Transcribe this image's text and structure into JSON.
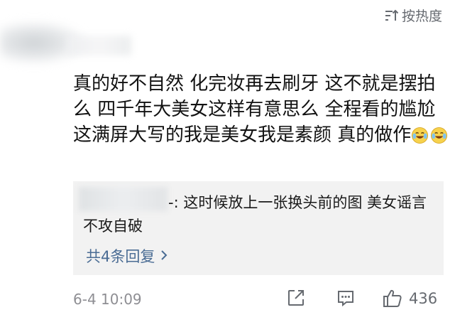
{
  "sort": {
    "label": "按热度"
  },
  "comment": {
    "text": "真的好不自然  化完妆再去刷牙  这不就是摆拍么  四千年大美女这样有意思么 全程看的尴尬  这满屏大写的我是美女我是素颜  真的做作",
    "emojis": [
      "laugh-cry-emoji",
      "laugh-cry-emoji"
    ]
  },
  "reply": {
    "text": "-: 这时候放上一张换头前的图 美女谣言不攻自破",
    "more_label": "共4条回复"
  },
  "footer": {
    "timestamp": "6-4 10:09",
    "like_count": "436"
  },
  "colors": {
    "link": "#4a6c94",
    "muted": "#8e8e93",
    "reply_bg": "#f2f2f2",
    "emoji_face": "#f7d24c"
  }
}
